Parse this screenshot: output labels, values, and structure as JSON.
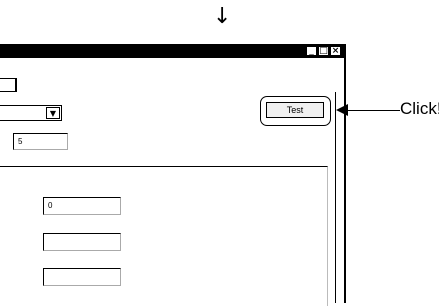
{
  "annotation": {
    "down_arrow": "↓",
    "click_label": "Click!"
  },
  "window": {
    "controls": {
      "minimize": "_",
      "maximize": "□",
      "close": "×"
    }
  },
  "form": {
    "combo_arrow": "▼",
    "count_value": "5",
    "test_button_label": "Test",
    "fields": [
      {
        "value": "0"
      },
      {
        "value": ""
      },
      {
        "value": ""
      }
    ]
  }
}
